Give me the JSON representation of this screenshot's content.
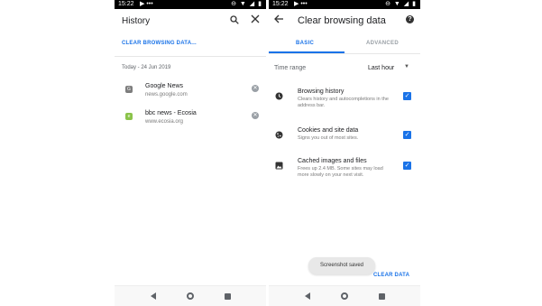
{
  "status_bar": {
    "time": "15:22",
    "left_icons": "▶ •••",
    "right_icons": "⊖ ▼ ◢ ▮"
  },
  "left": {
    "header": {
      "title": "History"
    },
    "clear_link": "CLEAR BROWSING DATA...",
    "date_header": "Today - 24 Jun 2019",
    "items": [
      {
        "title": "Google News",
        "url": "news.google.com",
        "favicon": "G",
        "favicon_color": "#7d7d7d"
      },
      {
        "title": "bbc news - Ecosia",
        "url": "www.ecosia.org",
        "favicon": "e",
        "favicon_color": "#8bc34a"
      }
    ]
  },
  "right": {
    "header": {
      "title": "Clear browsing data",
      "help": "?"
    },
    "tabs": [
      {
        "label": "BASIC",
        "active": true
      },
      {
        "label": "ADVANCED",
        "active": false
      }
    ],
    "time_range": {
      "label": "Time range",
      "value": "Last hour"
    },
    "options": [
      {
        "icon": "clock-icon",
        "title": "Browsing history",
        "sub": "Clears history and autocompletions in the address bar.",
        "checked": true
      },
      {
        "icon": "cookie-icon",
        "title": "Cookies and site data",
        "sub": "Signs you out of most sites.",
        "checked": true
      },
      {
        "icon": "image-icon",
        "title": "Cached images and files",
        "sub": "Frees up 2.4 MB. Some sites may load more slowly on your next visit.",
        "checked": true
      }
    ],
    "toast": "Screenshot saved",
    "clear_button": "CLEAR DATA"
  },
  "colors": {
    "accent": "#1a73e8",
    "status_bar": "#000000"
  }
}
